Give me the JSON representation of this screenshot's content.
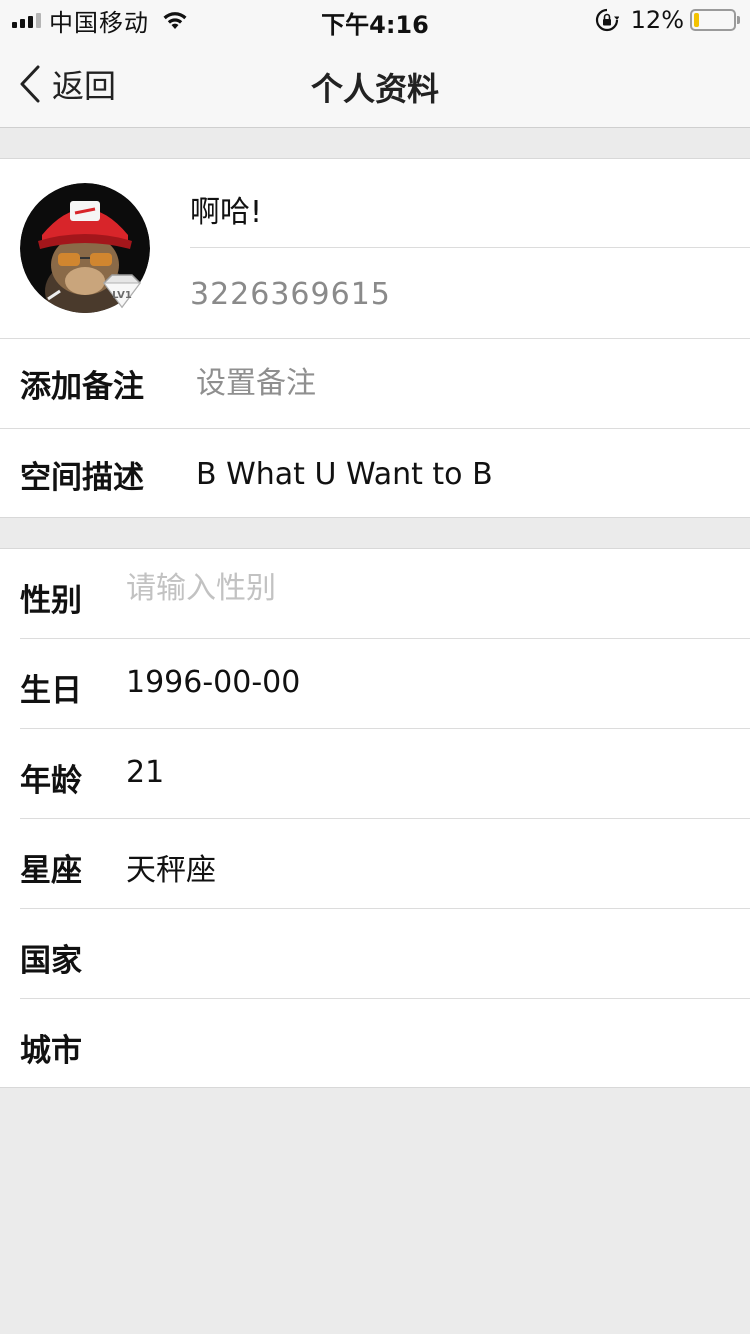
{
  "status_bar": {
    "carrier": "中国移动",
    "time": "下午4:16",
    "battery_percent": "12%",
    "battery_level": 0.12,
    "battery_color": "#f3c200"
  },
  "nav": {
    "back_label": "返回",
    "title": "个人资料"
  },
  "profile": {
    "nickname": "啊哈!",
    "qq_number": "3226369615",
    "level_badge": "LV1",
    "remark_label": "添加备注",
    "remark_placeholder": "设置备注",
    "space_label": "空间描述",
    "space_value": "B What U Want to B"
  },
  "info": {
    "gender_label": "性别",
    "gender_placeholder": "请输入性别",
    "birthday_label": "生日",
    "birthday_value": "1996-00-00",
    "age_label": "年龄",
    "age_value": "21",
    "zodiac_label": "星座",
    "zodiac_value": "天秤座",
    "country_label": "国家",
    "country_value": "",
    "city_label": "城市",
    "city_value": ""
  },
  "icons": {
    "back": "chevron-left-icon",
    "wifi": "wifi-icon",
    "signal": "cellular-signal-icon",
    "rotation_lock": "rotation-lock-icon",
    "battery": "battery-icon",
    "level": "diamond-level-icon"
  }
}
